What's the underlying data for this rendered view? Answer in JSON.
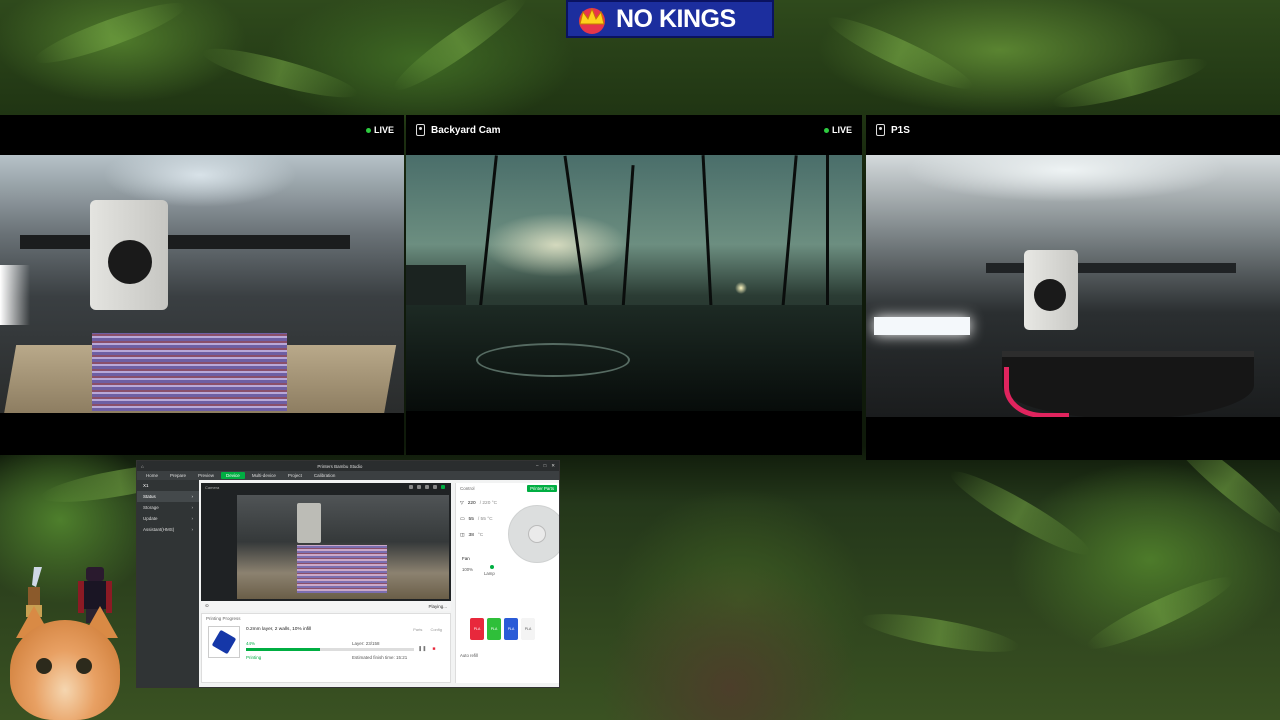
{
  "banner": {
    "text": "NO KINGS"
  },
  "cams": {
    "left": {
      "title": "",
      "live": "LIVE"
    },
    "center": {
      "title": "Backyard Cam",
      "live": "LIVE"
    },
    "right": {
      "title": "P1S",
      "live": ""
    }
  },
  "app": {
    "window_title": "Printers Bambu Studio",
    "tabs": [
      "Home",
      "Prepare",
      "Preview",
      "Device",
      "Multi-device",
      "Project",
      "Calibration"
    ],
    "active_tab": "Device",
    "printer_name": "X1",
    "sidebar": [
      "Status",
      "Storage",
      "Update",
      "Assistant(HMS)"
    ],
    "camera_label": "Camera",
    "camera_footer_right": "Playing...",
    "progress": {
      "title": "Printing Progress",
      "job_name": "0.2mm layer, 2 walls, 10% infill",
      "percent_label": "44%",
      "percent_value": 0.44,
      "layer_label": "Layer: 23/158",
      "state": "Printing",
      "eta_label": "Estimated finish time: 15:21",
      "buttons": [
        "Parts",
        "Config"
      ]
    },
    "control": {
      "title": "Control",
      "parts_button": "Printer Parts",
      "temps": [
        {
          "value": "220",
          "target": "/ 220 °C"
        },
        {
          "value": "55",
          "target": "/ 55 °C"
        },
        {
          "value": "38",
          "target": "°C"
        }
      ],
      "fan_label": "Fan",
      "speed_label": "100%",
      "lamp_label": "Lamp",
      "slots": [
        {
          "label": "PLA",
          "color": "#e8283c"
        },
        {
          "label": "PLA",
          "color": "#2fbf3a"
        },
        {
          "label": "PLA",
          "color": "#2a5bd7"
        },
        {
          "label": "PLA",
          "color": "#f4f4f4"
        }
      ],
      "auto_refill": "Auto refill"
    }
  }
}
